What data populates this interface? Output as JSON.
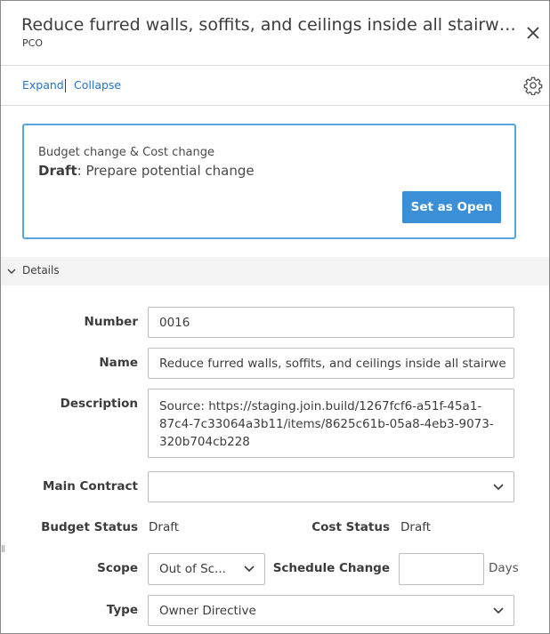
{
  "header": {
    "title": "Reduce furred walls, soffits, and ceilings inside all stairwells",
    "subtitle": "PCO"
  },
  "toolbar": {
    "expand_label": "Expand",
    "collapse_label": "Collapse"
  },
  "status_card": {
    "types": "Budget change & Cost change",
    "state": "Draft",
    "state_desc": ": Prepare potential change",
    "action_label": "Set as Open"
  },
  "section": {
    "label": "Details"
  },
  "form": {
    "number_label": "Number",
    "number_value": "0016",
    "name_label": "Name",
    "name_value": "Reduce furred walls, soffits, and ceilings inside all stairwells",
    "description_label": "Description",
    "description_value": "Source: https://staging.join.build/1267fcf6-a51f-45a1-87c4-7c33064a3b11/items/8625c61b-05a8-4eb3-9073-320b704cb228",
    "main_contract_label": "Main Contract",
    "main_contract_value": "",
    "budget_status_label": "Budget Status",
    "budget_status_value": "Draft",
    "cost_status_label": "Cost Status",
    "cost_status_value": "Draft",
    "scope_label": "Scope",
    "scope_value": "Out of Sc...",
    "schedule_change_label": "Schedule Change",
    "schedule_change_value": "",
    "schedule_unit": "Days",
    "type_label": "Type",
    "type_value": "Owner Directive"
  },
  "icons": {
    "close": "close-icon",
    "settings": "gear-icon",
    "section_toggle": "chevron-down-icon",
    "dropdown": "chevron-down-icon"
  },
  "colors": {
    "accent": "#3a8fd7",
    "card_border": "#57a6de",
    "link": "#2473c9",
    "section_bg": "#f3f3f3"
  }
}
